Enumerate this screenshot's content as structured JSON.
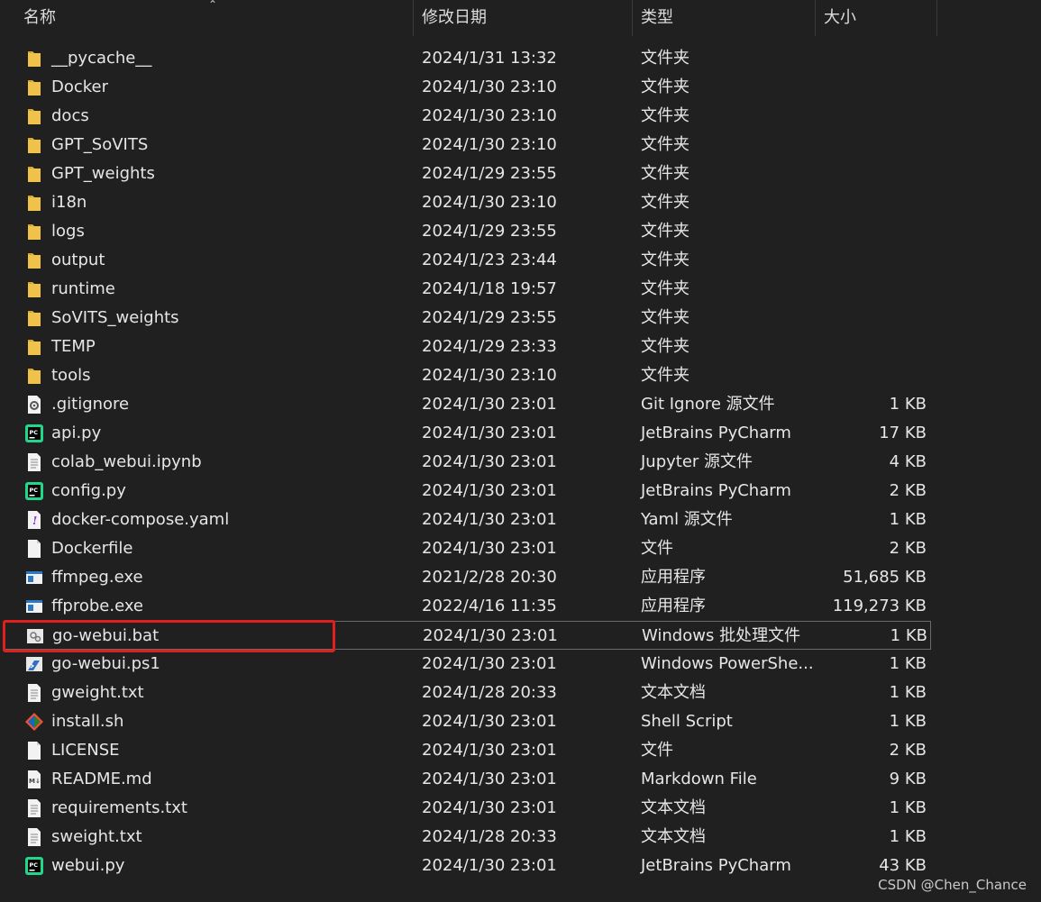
{
  "columns": {
    "name": "名称",
    "date": "修改日期",
    "type": "类型",
    "size": "大小"
  },
  "files": [
    {
      "name": "__pycache__",
      "date": "2024/1/31 13:32",
      "type": "文件夹",
      "size": "",
      "icon": "folder-icon"
    },
    {
      "name": "Docker",
      "date": "2024/1/30 23:10",
      "type": "文件夹",
      "size": "",
      "icon": "folder-icon"
    },
    {
      "name": "docs",
      "date": "2024/1/30 23:10",
      "type": "文件夹",
      "size": "",
      "icon": "folder-icon"
    },
    {
      "name": "GPT_SoVITS",
      "date": "2024/1/30 23:10",
      "type": "文件夹",
      "size": "",
      "icon": "folder-icon"
    },
    {
      "name": "GPT_weights",
      "date": "2024/1/29 23:55",
      "type": "文件夹",
      "size": "",
      "icon": "folder-icon"
    },
    {
      "name": "i18n",
      "date": "2024/1/30 23:10",
      "type": "文件夹",
      "size": "",
      "icon": "folder-icon"
    },
    {
      "name": "logs",
      "date": "2024/1/29 23:55",
      "type": "文件夹",
      "size": "",
      "icon": "folder-icon"
    },
    {
      "name": "output",
      "date": "2024/1/23 23:44",
      "type": "文件夹",
      "size": "",
      "icon": "folder-icon"
    },
    {
      "name": "runtime",
      "date": "2024/1/18 19:57",
      "type": "文件夹",
      "size": "",
      "icon": "folder-icon"
    },
    {
      "name": "SoVITS_weights",
      "date": "2024/1/29 23:55",
      "type": "文件夹",
      "size": "",
      "icon": "folder-icon"
    },
    {
      "name": "TEMP",
      "date": "2024/1/29 23:33",
      "type": "文件夹",
      "size": "",
      "icon": "folder-icon"
    },
    {
      "name": "tools",
      "date": "2024/1/30 23:10",
      "type": "文件夹",
      "size": "",
      "icon": "folder-icon"
    },
    {
      "name": ".gitignore",
      "date": "2024/1/30 23:01",
      "type": "Git Ignore 源文件",
      "size": "1 KB",
      "icon": "gear-file-icon"
    },
    {
      "name": "api.py",
      "date": "2024/1/30 23:01",
      "type": "JetBrains PyCharm",
      "size": "17 KB",
      "icon": "pycharm-icon"
    },
    {
      "name": "colab_webui.ipynb",
      "date": "2024/1/30 23:01",
      "type": "Jupyter 源文件",
      "size": "4 KB",
      "icon": "text-file-icon"
    },
    {
      "name": "config.py",
      "date": "2024/1/30 23:01",
      "type": "JetBrains PyCharm",
      "size": "2 KB",
      "icon": "pycharm-icon"
    },
    {
      "name": "docker-compose.yaml",
      "date": "2024/1/30 23:01",
      "type": "Yaml 源文件",
      "size": "1 KB",
      "icon": "yaml-file-icon"
    },
    {
      "name": "Dockerfile",
      "date": "2024/1/30 23:01",
      "type": "文件",
      "size": "2 KB",
      "icon": "blank-file-icon"
    },
    {
      "name": "ffmpeg.exe",
      "date": "2021/2/28 20:30",
      "type": "应用程序",
      "size": "51,685 KB",
      "icon": "exe-icon"
    },
    {
      "name": "ffprobe.exe",
      "date": "2022/4/16 11:35",
      "type": "应用程序",
      "size": "119,273 KB",
      "icon": "exe-icon"
    },
    {
      "name": "go-webui.bat",
      "date": "2024/1/30 23:01",
      "type": "Windows 批处理文件",
      "size": "1 KB",
      "icon": "batch-file-icon",
      "selected": true
    },
    {
      "name": "go-webui.ps1",
      "date": "2024/1/30 23:01",
      "type": "Windows PowerShe...",
      "size": "1 KB",
      "icon": "powershell-file-icon"
    },
    {
      "name": "gweight.txt",
      "date": "2024/1/28 20:33",
      "type": "文本文档",
      "size": "1 KB",
      "icon": "text-file-icon"
    },
    {
      "name": "install.sh",
      "date": "2024/1/30 23:01",
      "type": "Shell Script",
      "size": "1 KB",
      "icon": "git-bash-icon"
    },
    {
      "name": "LICENSE",
      "date": "2024/1/30 23:01",
      "type": "文件",
      "size": "2 KB",
      "icon": "blank-file-icon"
    },
    {
      "name": "README.md",
      "date": "2024/1/30 23:01",
      "type": "Markdown File",
      "size": "9 KB",
      "icon": "markdown-file-icon"
    },
    {
      "name": "requirements.txt",
      "date": "2024/1/30 23:01",
      "type": "文本文档",
      "size": "1 KB",
      "icon": "text-file-icon"
    },
    {
      "name": "sweight.txt",
      "date": "2024/1/28 20:33",
      "type": "文本文档",
      "size": "1 KB",
      "icon": "text-file-icon"
    },
    {
      "name": "webui.py",
      "date": "2024/1/30 23:01",
      "type": "JetBrains PyCharm",
      "size": "43 KB",
      "icon": "pycharm-icon"
    }
  ],
  "watermark": "CSDN @Chen_Chance",
  "colors": {
    "background": "#202020",
    "folder": "#f0c24a",
    "highlight": "#e0201c",
    "pycharm": "#21d789"
  }
}
